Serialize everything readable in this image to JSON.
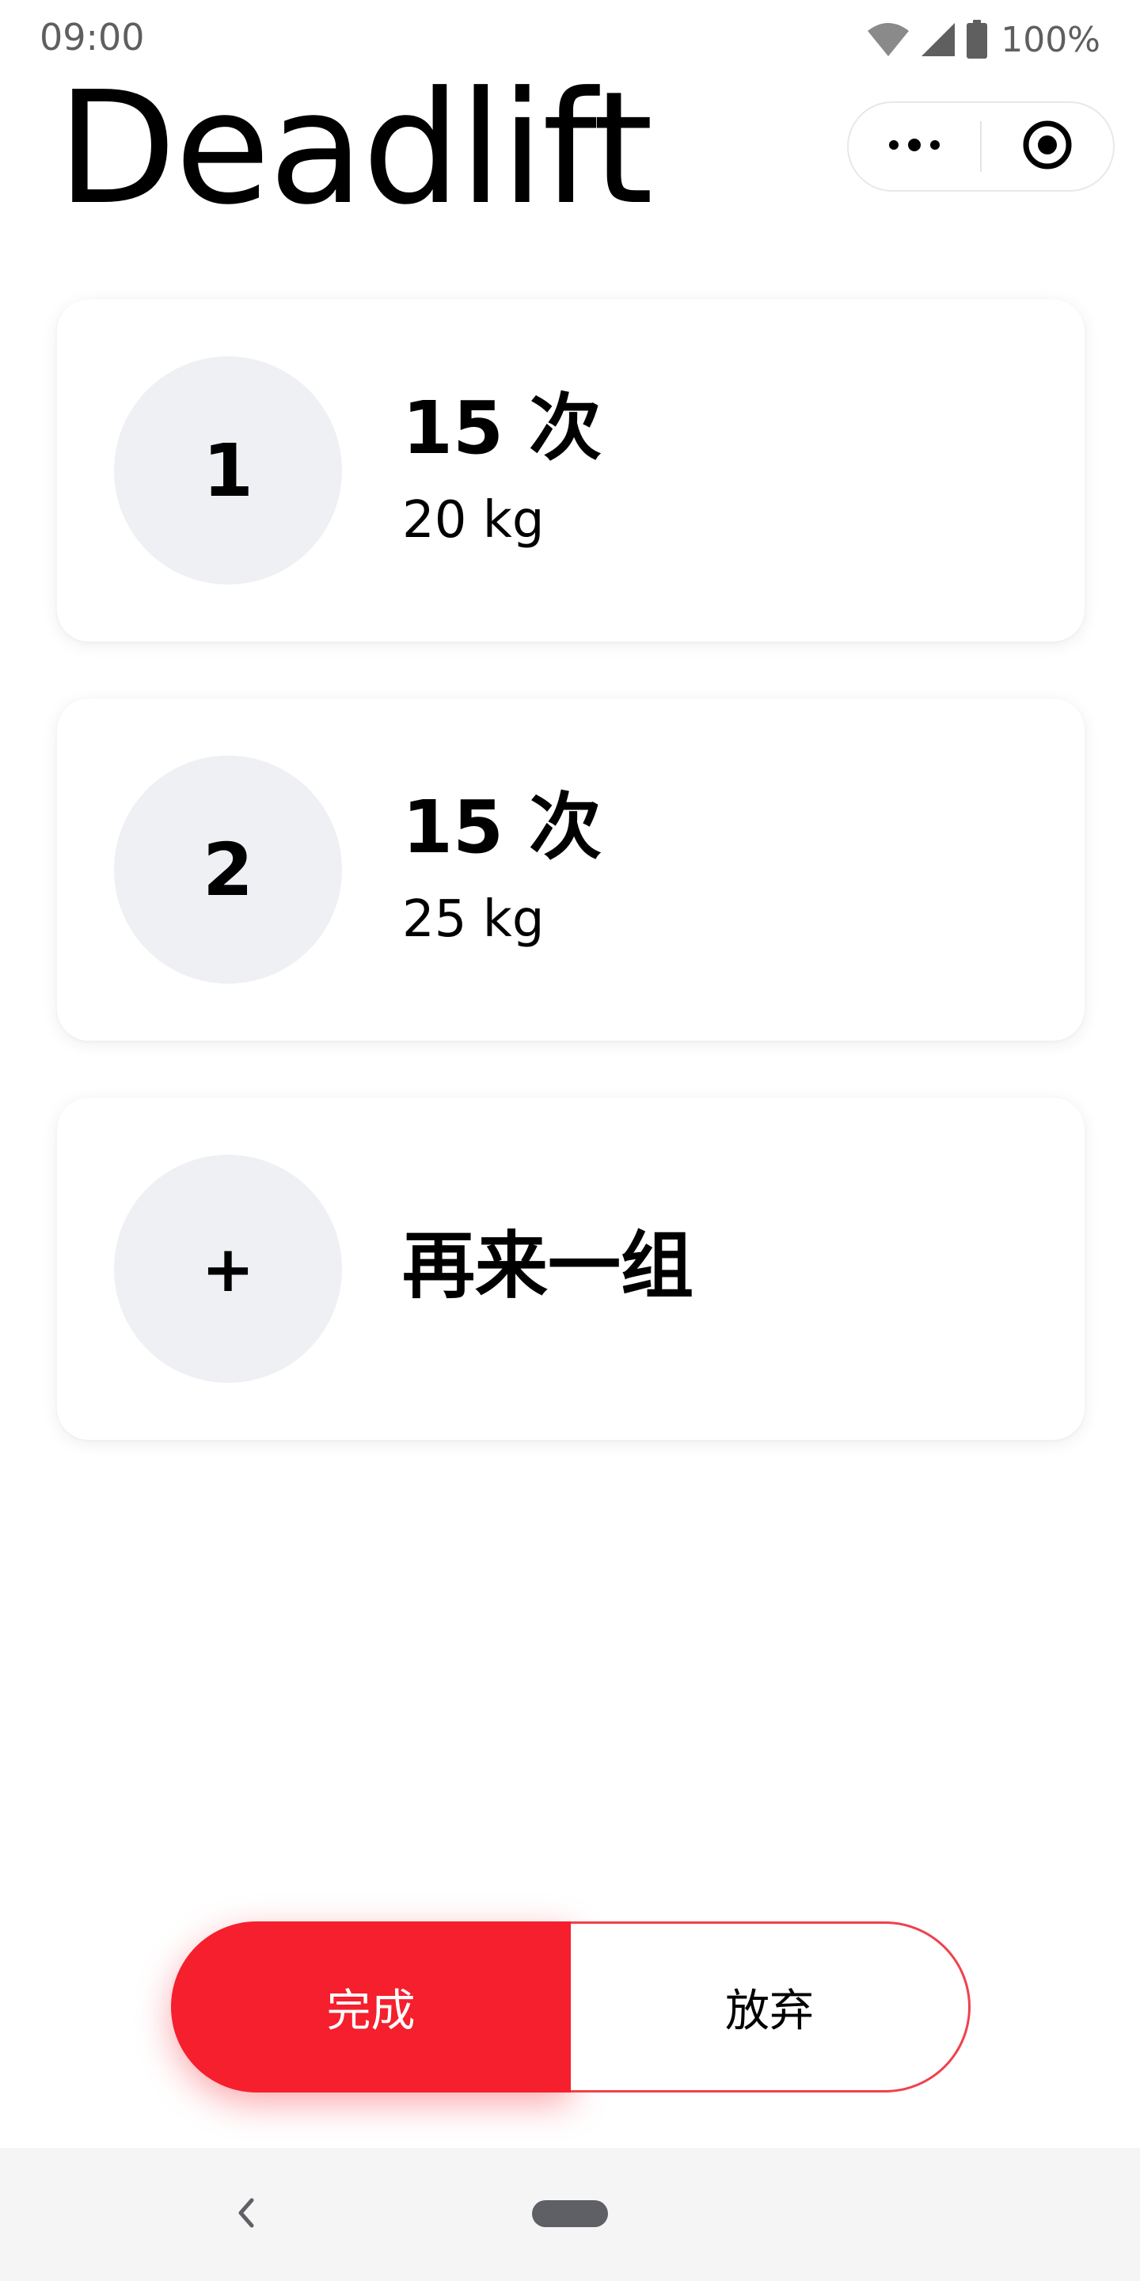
{
  "status_bar": {
    "time": "09:00",
    "battery": "100%",
    "icons": [
      "wifi-icon",
      "signal-icon",
      "battery-icon"
    ]
  },
  "header": {
    "title": "Deadlift",
    "menu_icon": "more-dots-icon",
    "close_icon": "target-circle-icon"
  },
  "sets": [
    {
      "index": "1",
      "reps": "15 次",
      "weight": "20 kg"
    },
    {
      "index": "2",
      "reps": "15 次",
      "weight": "25 kg"
    }
  ],
  "add_set": {
    "symbol": "+",
    "label": "再来一组"
  },
  "actions": {
    "complete_label": "完成",
    "abandon_label": "放弃"
  },
  "nav": {
    "back_icon": "chevron-left-icon",
    "home_icon": "home-pill-icon"
  },
  "colors": {
    "accent": "#f51f2d",
    "circle_bg": "#eef0f4",
    "nav_bg": "#f5f5f5"
  }
}
